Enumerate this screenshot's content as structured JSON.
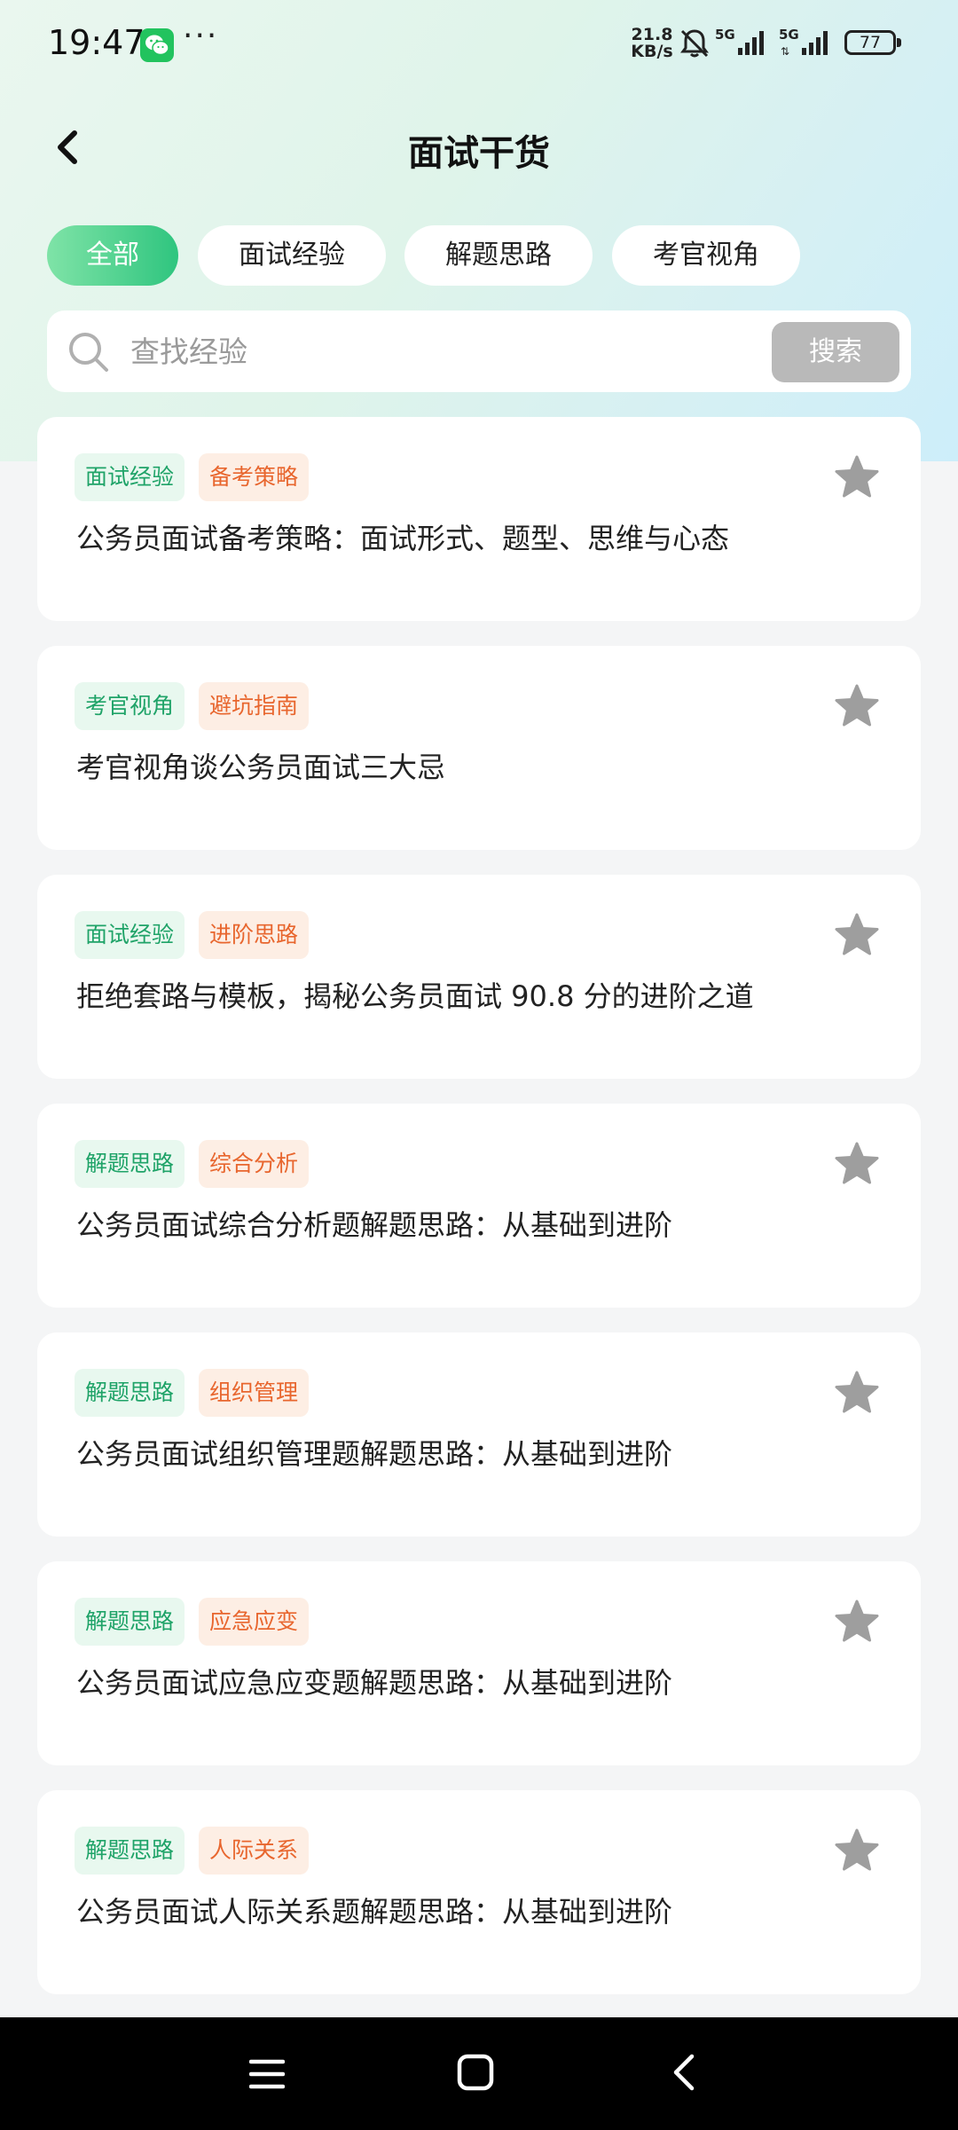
{
  "status_bar": {
    "time": "19:47",
    "dots": "···",
    "net_speed_value": "21.8",
    "net_speed_unit": "KB/s",
    "battery": "77",
    "icons": [
      "wechat-icon",
      "bell-muted-icon",
      "signal-5g-icon",
      "signal-5g-icon",
      "battery-icon"
    ]
  },
  "header": {
    "title": "面试干货",
    "back_icon": "chevron-left-icon"
  },
  "tabs": [
    {
      "label": "全部",
      "active": true
    },
    {
      "label": "面试经验",
      "active": false
    },
    {
      "label": "解题思路",
      "active": false
    },
    {
      "label": "考官视角",
      "active": false
    }
  ],
  "search": {
    "placeholder": "查找经验",
    "value": "",
    "button_label": "搜索"
  },
  "articles": [
    {
      "tags": [
        "面试经验",
        "备考策略"
      ],
      "title": "公务员面试备考策略：面试形式、题型、思维与心态"
    },
    {
      "tags": [
        "考官视角",
        "避坑指南"
      ],
      "title": "考官视角谈公务员面试三大忌"
    },
    {
      "tags": [
        "面试经验",
        "进阶思路"
      ],
      "title": "拒绝套路与模板，揭秘公务员面试 90.8 分的进阶之道"
    },
    {
      "tags": [
        "解题思路",
        "综合分析"
      ],
      "title": "公务员面试综合分析题解题思路：从基础到进阶"
    },
    {
      "tags": [
        "解题思路",
        "组织管理"
      ],
      "title": "公务员面试组织管理题解题思路：从基础到进阶"
    },
    {
      "tags": [
        "解题思路",
        "应急应变"
      ],
      "title": "公务员面试应急应变题解题思路：从基础到进阶"
    },
    {
      "tags": [
        "解题思路",
        "人际关系"
      ],
      "title": "公务员面试人际关系题解题思路：从基础到进阶"
    }
  ],
  "colors": {
    "accent": "#2fc57f",
    "tag_primary_text": "#1fa368",
    "tag_primary_bg": "#e8f8ef",
    "tag_secondary_text": "#e8662e",
    "tag_secondary_bg": "#fdeee4",
    "star": "#9e9e9e"
  },
  "nav_bar": {
    "icons": [
      "menu-icon",
      "home-icon",
      "back-icon"
    ]
  }
}
